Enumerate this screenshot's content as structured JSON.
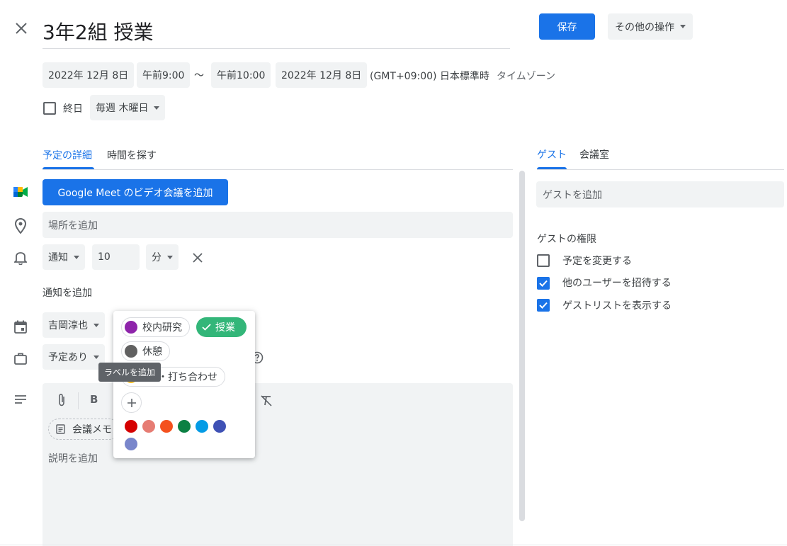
{
  "header": {
    "title": "3年2組 授業",
    "save_label": "保存",
    "more_actions_label": "その他の操作"
  },
  "datetime": {
    "start_date": "2022年 12月 8日",
    "start_time": "午前9:00",
    "separator": "〜",
    "end_time": "午前10:00",
    "end_date": "2022年 12月 8日",
    "timezone_text": "(GMT+09:00) 日本標準時",
    "timezone_link": "タイムゾーン",
    "all_day_label": "終日",
    "repeat_label": "毎週 木曜日"
  },
  "tabs": {
    "details": "予定の詳細",
    "find_time": "時間を探す",
    "guests": "ゲスト",
    "rooms": "会議室"
  },
  "details": {
    "meet_button": "Google Meet のビデオ会議を追加",
    "location_placeholder": "場所を追加",
    "notification_type": "通知",
    "notification_value": "10",
    "notification_unit": "分",
    "add_notification": "通知を追加",
    "calendar_owner": "吉岡淳也",
    "availability": "予定あり",
    "meeting_notes": "会議メモ",
    "description_placeholder": "説明を追加"
  },
  "label_popup": {
    "labels": [
      {
        "name": "校内研究",
        "color": "#8e24aa",
        "selected": false
      },
      {
        "name": "授業",
        "color": "#33b679",
        "selected": true
      },
      {
        "name": "休憩",
        "color": "#616161",
        "selected": false
      },
      {
        "name": "・打ち合わせ",
        "color": "#f6bf26",
        "selected": false
      }
    ],
    "tooltip": "ラベルを追加",
    "swatches": [
      "#d50000",
      "#e67c73",
      "#f4511e",
      "#0b8043",
      "#039be5",
      "#3f51b5",
      "#7986cb"
    ]
  },
  "guests": {
    "add_placeholder": "ゲストを追加",
    "permissions_title": "ゲストの権限",
    "permissions": [
      {
        "label": "予定を変更する",
        "checked": false
      },
      {
        "label": "他のユーザーを招待する",
        "checked": true
      },
      {
        "label": "ゲストリストを表示する",
        "checked": true
      }
    ]
  },
  "colors": {
    "accent": "#1a73e8",
    "chip_bg": "#f1f3f4"
  }
}
